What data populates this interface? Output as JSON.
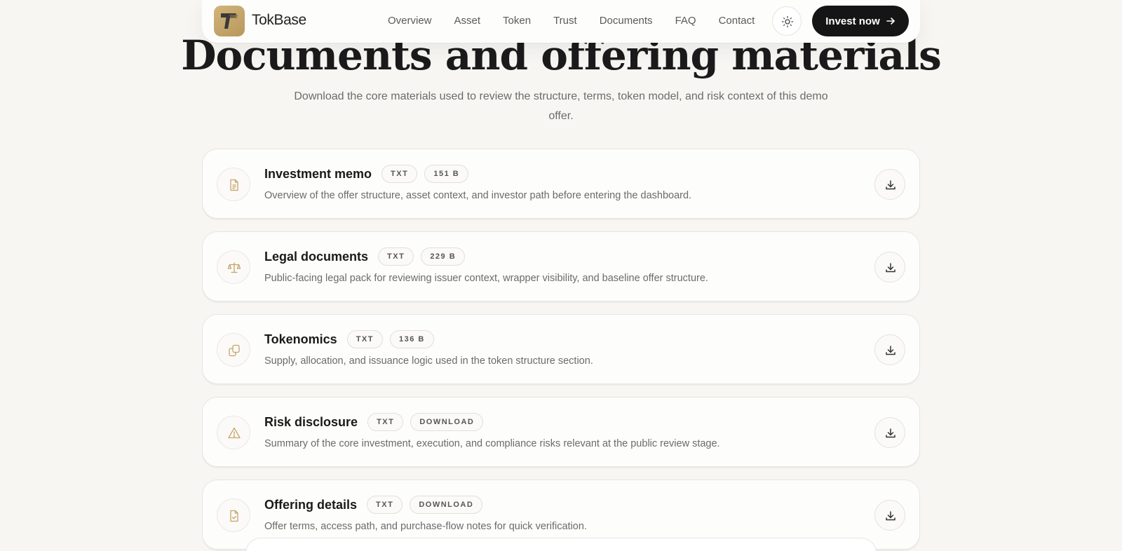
{
  "nav": {
    "brand": "TokBase",
    "links": [
      "Overview",
      "Asset",
      "Token",
      "Trust",
      "Documents",
      "FAQ",
      "Contact"
    ],
    "cta_label": "Invest now",
    "cta_icon": "arrow-right-icon",
    "theme_icon": "sun-icon"
  },
  "hero": {
    "title": "Documents and offering materials",
    "subtitle": "Download the core materials used to review the structure, terms, token model, and risk context of this demo offer."
  },
  "documents": [
    {
      "title": "Investment memo",
      "format": "TXT",
      "meta": "151 B",
      "icon": "document-icon",
      "description": "Overview of the offer structure, asset context, and investor path before entering the dashboard."
    },
    {
      "title": "Legal documents",
      "format": "TXT",
      "meta": "229 B",
      "icon": "scale-icon",
      "description": "Public-facing legal pack for reviewing issuer context, wrapper visibility, and baseline offer structure."
    },
    {
      "title": "Tokenomics",
      "format": "TXT",
      "meta": "136 B",
      "icon": "copy-icon",
      "description": "Supply, allocation, and issuance logic used in the token structure section."
    },
    {
      "title": "Risk disclosure",
      "format": "TXT",
      "meta": "DOWNLOAD",
      "icon": "warning-icon",
      "description": "Summary of the core investment, execution, and compliance risks relevant at the public review stage."
    },
    {
      "title": "Offering details",
      "format": "TXT",
      "meta": "DOWNLOAD",
      "icon": "file-check-icon",
      "description": "Offer terms, access path, and purchase-flow notes for quick verification."
    }
  ],
  "colors": {
    "accent": "#c4a468",
    "dark": "#151515",
    "background": "#f7f6f3"
  }
}
